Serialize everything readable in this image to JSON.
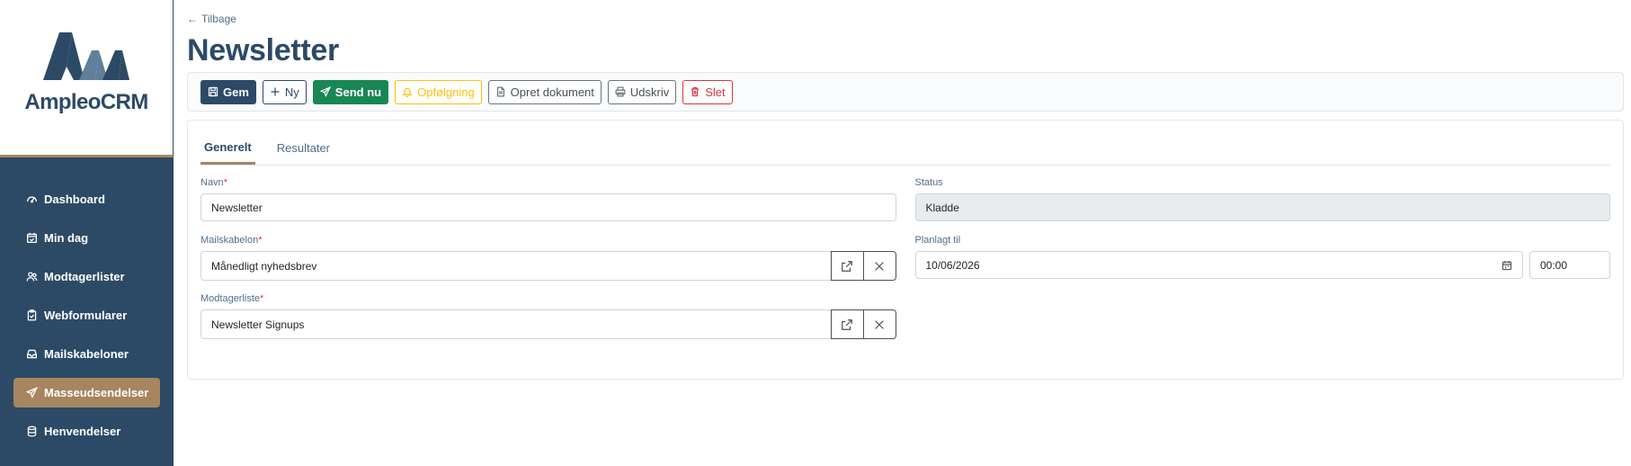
{
  "brand": {
    "name": "AmpleoCRM",
    "primary": "#2c4a66",
    "accent": "#a6855f"
  },
  "sidebar": {
    "items": [
      {
        "label": "Dashboard",
        "icon": "speedometer-icon",
        "active": false
      },
      {
        "label": "Min dag",
        "icon": "calendar-check-icon",
        "active": false
      },
      {
        "label": "Modtagerlister",
        "icon": "people-icon",
        "active": false
      },
      {
        "label": "Webformularer",
        "icon": "clipboard-check-icon",
        "active": false
      },
      {
        "label": "Mailskabeloner",
        "icon": "inbox-icon",
        "active": false
      },
      {
        "label": "Masseudsendelser",
        "icon": "send-icon",
        "active": true
      },
      {
        "label": "Henvendelser",
        "icon": "database-icon",
        "active": false
      }
    ]
  },
  "header": {
    "back_label": "Tilbage",
    "title": "Newsletter"
  },
  "toolbar": {
    "save_label": "Gem",
    "new_label": "Ny",
    "send_label": "Send nu",
    "followup_label": "Opfølgning",
    "create_doc_label": "Opret dokument",
    "print_label": "Udskriv",
    "delete_label": "Slet"
  },
  "tabs": [
    {
      "label": "Generelt",
      "active": true
    },
    {
      "label": "Resultater",
      "active": false
    }
  ],
  "form": {
    "name": {
      "label": "Navn",
      "required": "*",
      "value": "Newsletter"
    },
    "status": {
      "label": "Status",
      "value": "Kladde"
    },
    "template": {
      "label": "Mailskabelon",
      "required": "*",
      "value": "Månedligt nyhedsbrev"
    },
    "scheduled": {
      "label": "Planlagt til",
      "date": "10/06/2026",
      "time": "00:00"
    },
    "recipient_list": {
      "label": "Modtagerliste",
      "required": "*",
      "value": "Newsletter Signups"
    }
  }
}
